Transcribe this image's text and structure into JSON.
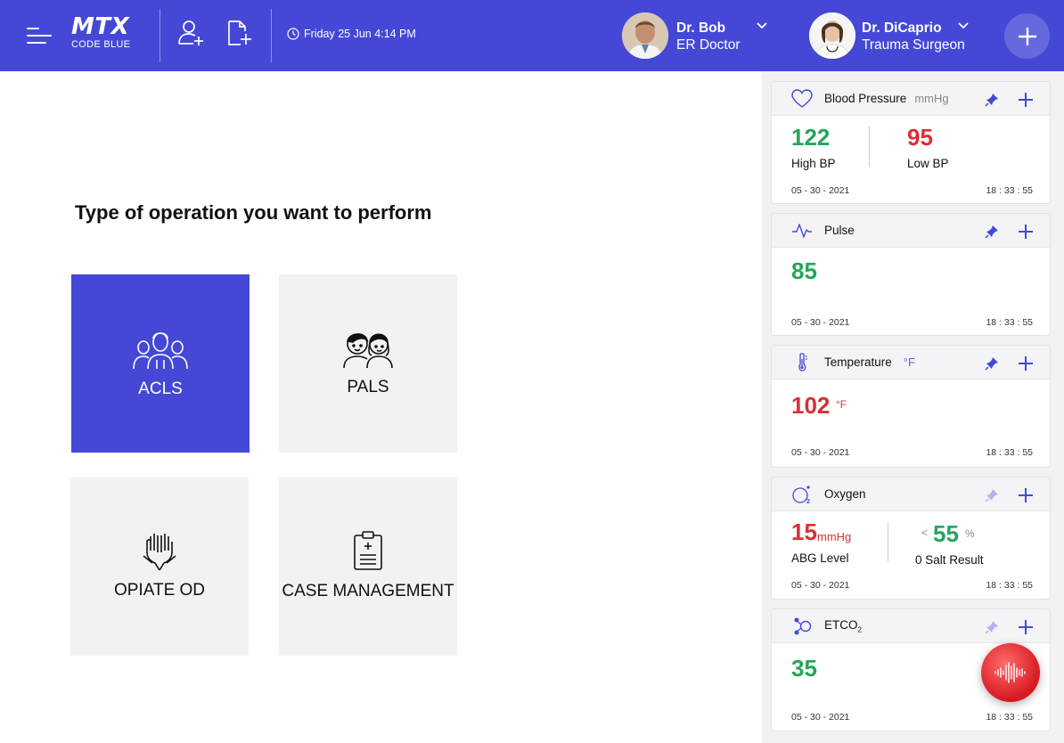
{
  "header": {
    "logo_main": "MTX",
    "logo_sub": "CODE BLUE",
    "datetime": "Friday 25 Jun 4:14 PM",
    "profiles": [
      {
        "name": "Dr. Bob",
        "role": "ER Doctor"
      },
      {
        "name": "Dr. DiCaprio",
        "role": "Trauma Surgeon"
      }
    ],
    "icons": [
      "menu-icon",
      "add-patient-icon",
      "add-document-icon",
      "clock-icon",
      "chevron-down-icon",
      "plus-icon"
    ]
  },
  "main": {
    "title": "Type of operation you want to perform",
    "tiles": [
      {
        "label": "ACLS",
        "icon": "adult-group-icon",
        "active": true
      },
      {
        "label": "PALS",
        "icon": "children-icon",
        "active": false
      },
      {
        "label": "OPIATE OD",
        "icon": "hands-icon",
        "active": false
      },
      {
        "label": "CASE MANAGEMENT",
        "icon": "clipboard-icon",
        "active": false
      }
    ]
  },
  "vitals": {
    "blood_pressure": {
      "title": "Blood Pressure",
      "unit": "mmHg",
      "high_value": "122",
      "high_label": "High BP",
      "low_value": "95",
      "low_label": "Low BP",
      "date": "05 - 30 - 2021",
      "time": "18 : 33 : 55"
    },
    "pulse": {
      "title": "Pulse",
      "value": "85",
      "date": "05 - 30 - 2021",
      "time": "18 : 33 : 55"
    },
    "temperature": {
      "title": "Temperature",
      "unit": "°F",
      "value": "102",
      "value_unit": "°F",
      "date": "05 - 30 - 2021",
      "time": "18 : 33 : 55"
    },
    "oxygen": {
      "title": "Oxygen",
      "abg_value": "15",
      "abg_unit": "mmHg",
      "abg_label": "ABG Level",
      "salt_prefix": "<",
      "salt_value": "55",
      "salt_unit": "%",
      "salt_label": "0 Salt Result",
      "date": "05 - 30 - 2021",
      "time": "18 : 33 : 55"
    },
    "etco2": {
      "title": "ETCO",
      "title_sub": "2",
      "value": "35",
      "date": "05 - 30 - 2021",
      "time": "18 : 33 : 55"
    }
  },
  "colors": {
    "brand": "#4548d6",
    "green": "#24a55b",
    "red": "#dc2e36",
    "mic": "#d71920"
  }
}
